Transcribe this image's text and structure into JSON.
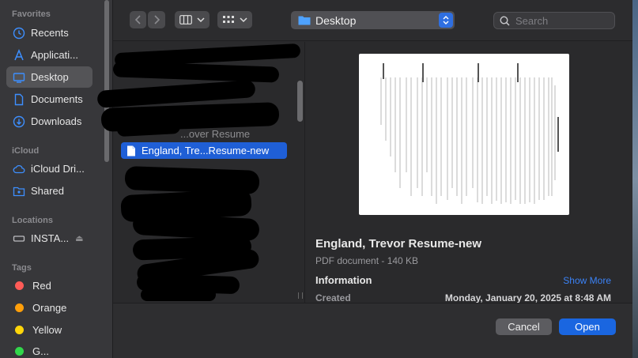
{
  "sidebar": {
    "favorites_header": "Favorites",
    "favorites": [
      {
        "label": "Recents",
        "icon": "clock-icon"
      },
      {
        "label": "Applicati...",
        "icon": "applications-icon"
      },
      {
        "label": "Desktop",
        "icon": "desktop-icon",
        "selected": true
      },
      {
        "label": "Documents",
        "icon": "document-icon"
      },
      {
        "label": "Downloads",
        "icon": "download-icon"
      }
    ],
    "icloud_header": "iCloud",
    "icloud": [
      {
        "label": "iCloud Dri...",
        "icon": "cloud-icon"
      },
      {
        "label": "Shared",
        "icon": "shared-folder-icon"
      }
    ],
    "locations_header": "Locations",
    "locations": [
      {
        "label": "INSTA...",
        "icon": "drive-icon"
      }
    ],
    "tags_header": "Tags",
    "tags": [
      {
        "label": "Red",
        "color": "#ff5b57"
      },
      {
        "label": "Orange",
        "color": "#ff9f0a"
      },
      {
        "label": "Yellow",
        "color": "#ffd60a"
      },
      {
        "label": "G...",
        "color": "#32d74b"
      }
    ]
  },
  "toolbar": {
    "location": "Desktop",
    "search_placeholder": "Search"
  },
  "file_column": {
    "partial_item": "...over Resume",
    "selected_item": "England, Tre...Resume-new"
  },
  "preview": {
    "file_name": "England, Trevor Resume-new",
    "file_kind": "PDF document - 140 KB",
    "info_header": "Information",
    "show_more": "Show More",
    "created_label": "Created",
    "created_value": "Monday, January 20, 2025 at 8:48 AM"
  },
  "footer": {
    "cancel_label": "Cancel",
    "open_label": "Open"
  },
  "colors": {
    "accent": "#1a66e0",
    "selection": "#1f5fd6",
    "link": "#3b82f6"
  }
}
